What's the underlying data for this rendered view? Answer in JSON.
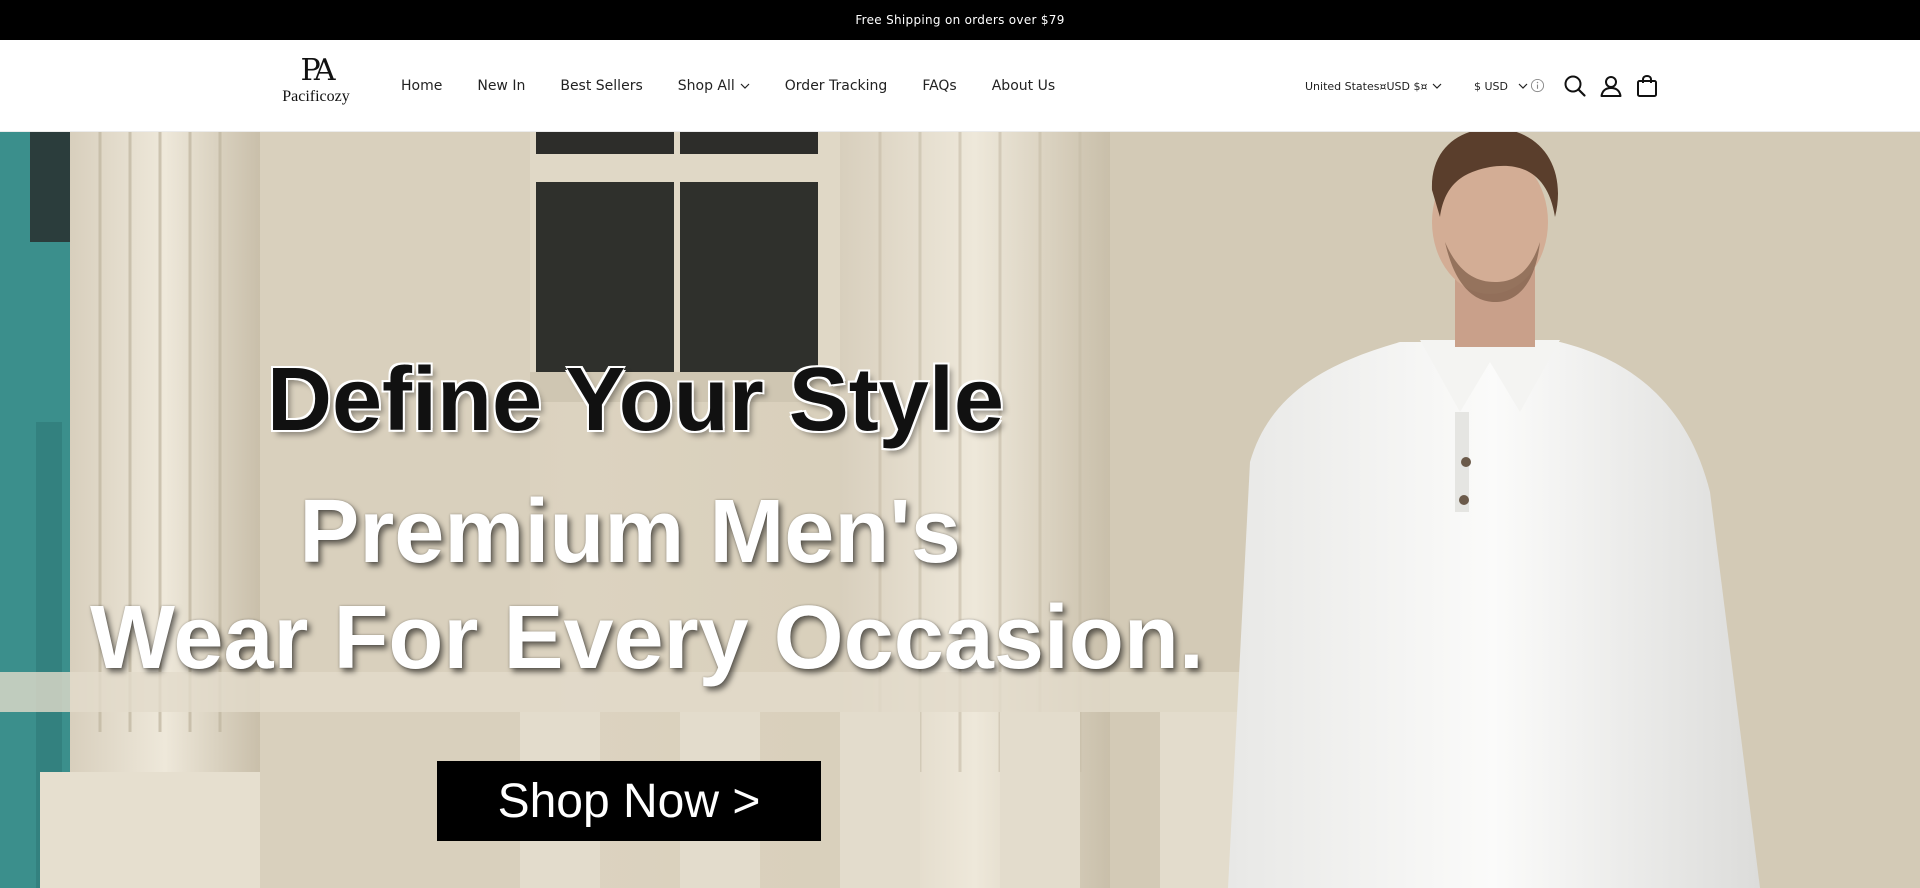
{
  "announcement": {
    "text": "Free Shipping on orders over $79"
  },
  "brand": {
    "mark": "PA",
    "name": "Pacificozy"
  },
  "nav": {
    "items": [
      {
        "label": "Home"
      },
      {
        "label": "New In"
      },
      {
        "label": "Best Sellers"
      },
      {
        "label": "Shop All",
        "has_dropdown": true
      },
      {
        "label": "Order Tracking"
      },
      {
        "label": "FAQs"
      },
      {
        "label": "About Us"
      }
    ]
  },
  "localization": {
    "country_label": "United States¤USD $¤",
    "currency_label": "$ USD"
  },
  "icons": {
    "info": "info-icon",
    "search": "search-icon",
    "account": "account-icon",
    "cart": "cart-icon"
  },
  "hero": {
    "headline": "Define Your Style",
    "subline_1": "Premium Men's",
    "subline_2": "Wear For Every Occasion.",
    "cta_label": "Shop Now >"
  },
  "colors": {
    "announcement_bg": "#000000",
    "announcement_text": "#ffffff",
    "cta_bg": "#000000",
    "cta_text": "#ffffff",
    "door_teal": "#3b8f8c"
  }
}
